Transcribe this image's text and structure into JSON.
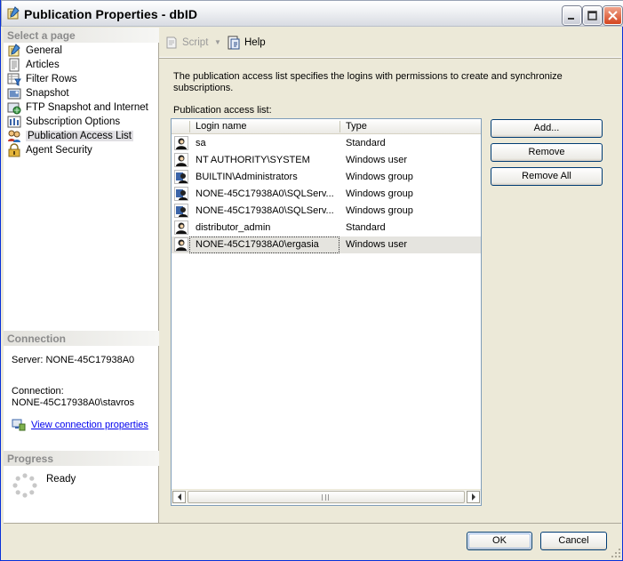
{
  "window": {
    "title": "Publication Properties - dbID"
  },
  "left_pane": {
    "select_page_header": "Select a page",
    "pages": [
      {
        "label": "General",
        "icon": "properties-icon"
      },
      {
        "label": "Articles",
        "icon": "document-icon"
      },
      {
        "label": "Filter Rows",
        "icon": "filter-icon"
      },
      {
        "label": "Snapshot",
        "icon": "snapshot-icon"
      },
      {
        "label": "FTP Snapshot and Internet",
        "icon": "ftp-icon"
      },
      {
        "label": "Subscription Options",
        "icon": "options-icon"
      },
      {
        "label": "Publication Access List",
        "icon": "users-icon",
        "selected": true
      },
      {
        "label": "Agent Security",
        "icon": "lock-icon"
      }
    ],
    "connection_header": "Connection",
    "server_text": "Server: NONE-45C17938A0",
    "connection_label": "Connection:",
    "connection_value": "NONE-45C17938A0\\stavros",
    "view_connection_link": "View connection properties",
    "progress_header": "Progress",
    "progress_status": "Ready"
  },
  "toolbar": {
    "script_label": "Script",
    "help_label": "Help"
  },
  "main": {
    "description": "The publication access list specifies the logins with permissions to create and synchronize subscriptions.",
    "list_label": "Publication access list:",
    "columns": [
      "Login name",
      "Type"
    ],
    "rows": [
      {
        "login": "sa",
        "type": "Standard",
        "icon": "user-icon"
      },
      {
        "login": "NT AUTHORITY\\SYSTEM",
        "type": "Windows user",
        "icon": "user-icon"
      },
      {
        "login": "BUILTIN\\Administrators",
        "type": "Windows group",
        "icon": "group-icon"
      },
      {
        "login": "NONE-45C17938A0\\SQLServ...",
        "type": "Windows group",
        "icon": "group-icon"
      },
      {
        "login": "NONE-45C17938A0\\SQLServ...",
        "type": "Windows group",
        "icon": "group-icon"
      },
      {
        "login": "distributor_admin",
        "type": "Standard",
        "icon": "user-icon"
      },
      {
        "login": "NONE-45C17938A0\\ergasia",
        "type": "Windows user",
        "icon": "user-icon",
        "selected": true
      }
    ],
    "add_button": "Add...",
    "remove_button": "Remove",
    "remove_all_button": "Remove All"
  },
  "footer": {
    "ok_button": "OK",
    "cancel_button": "Cancel"
  }
}
